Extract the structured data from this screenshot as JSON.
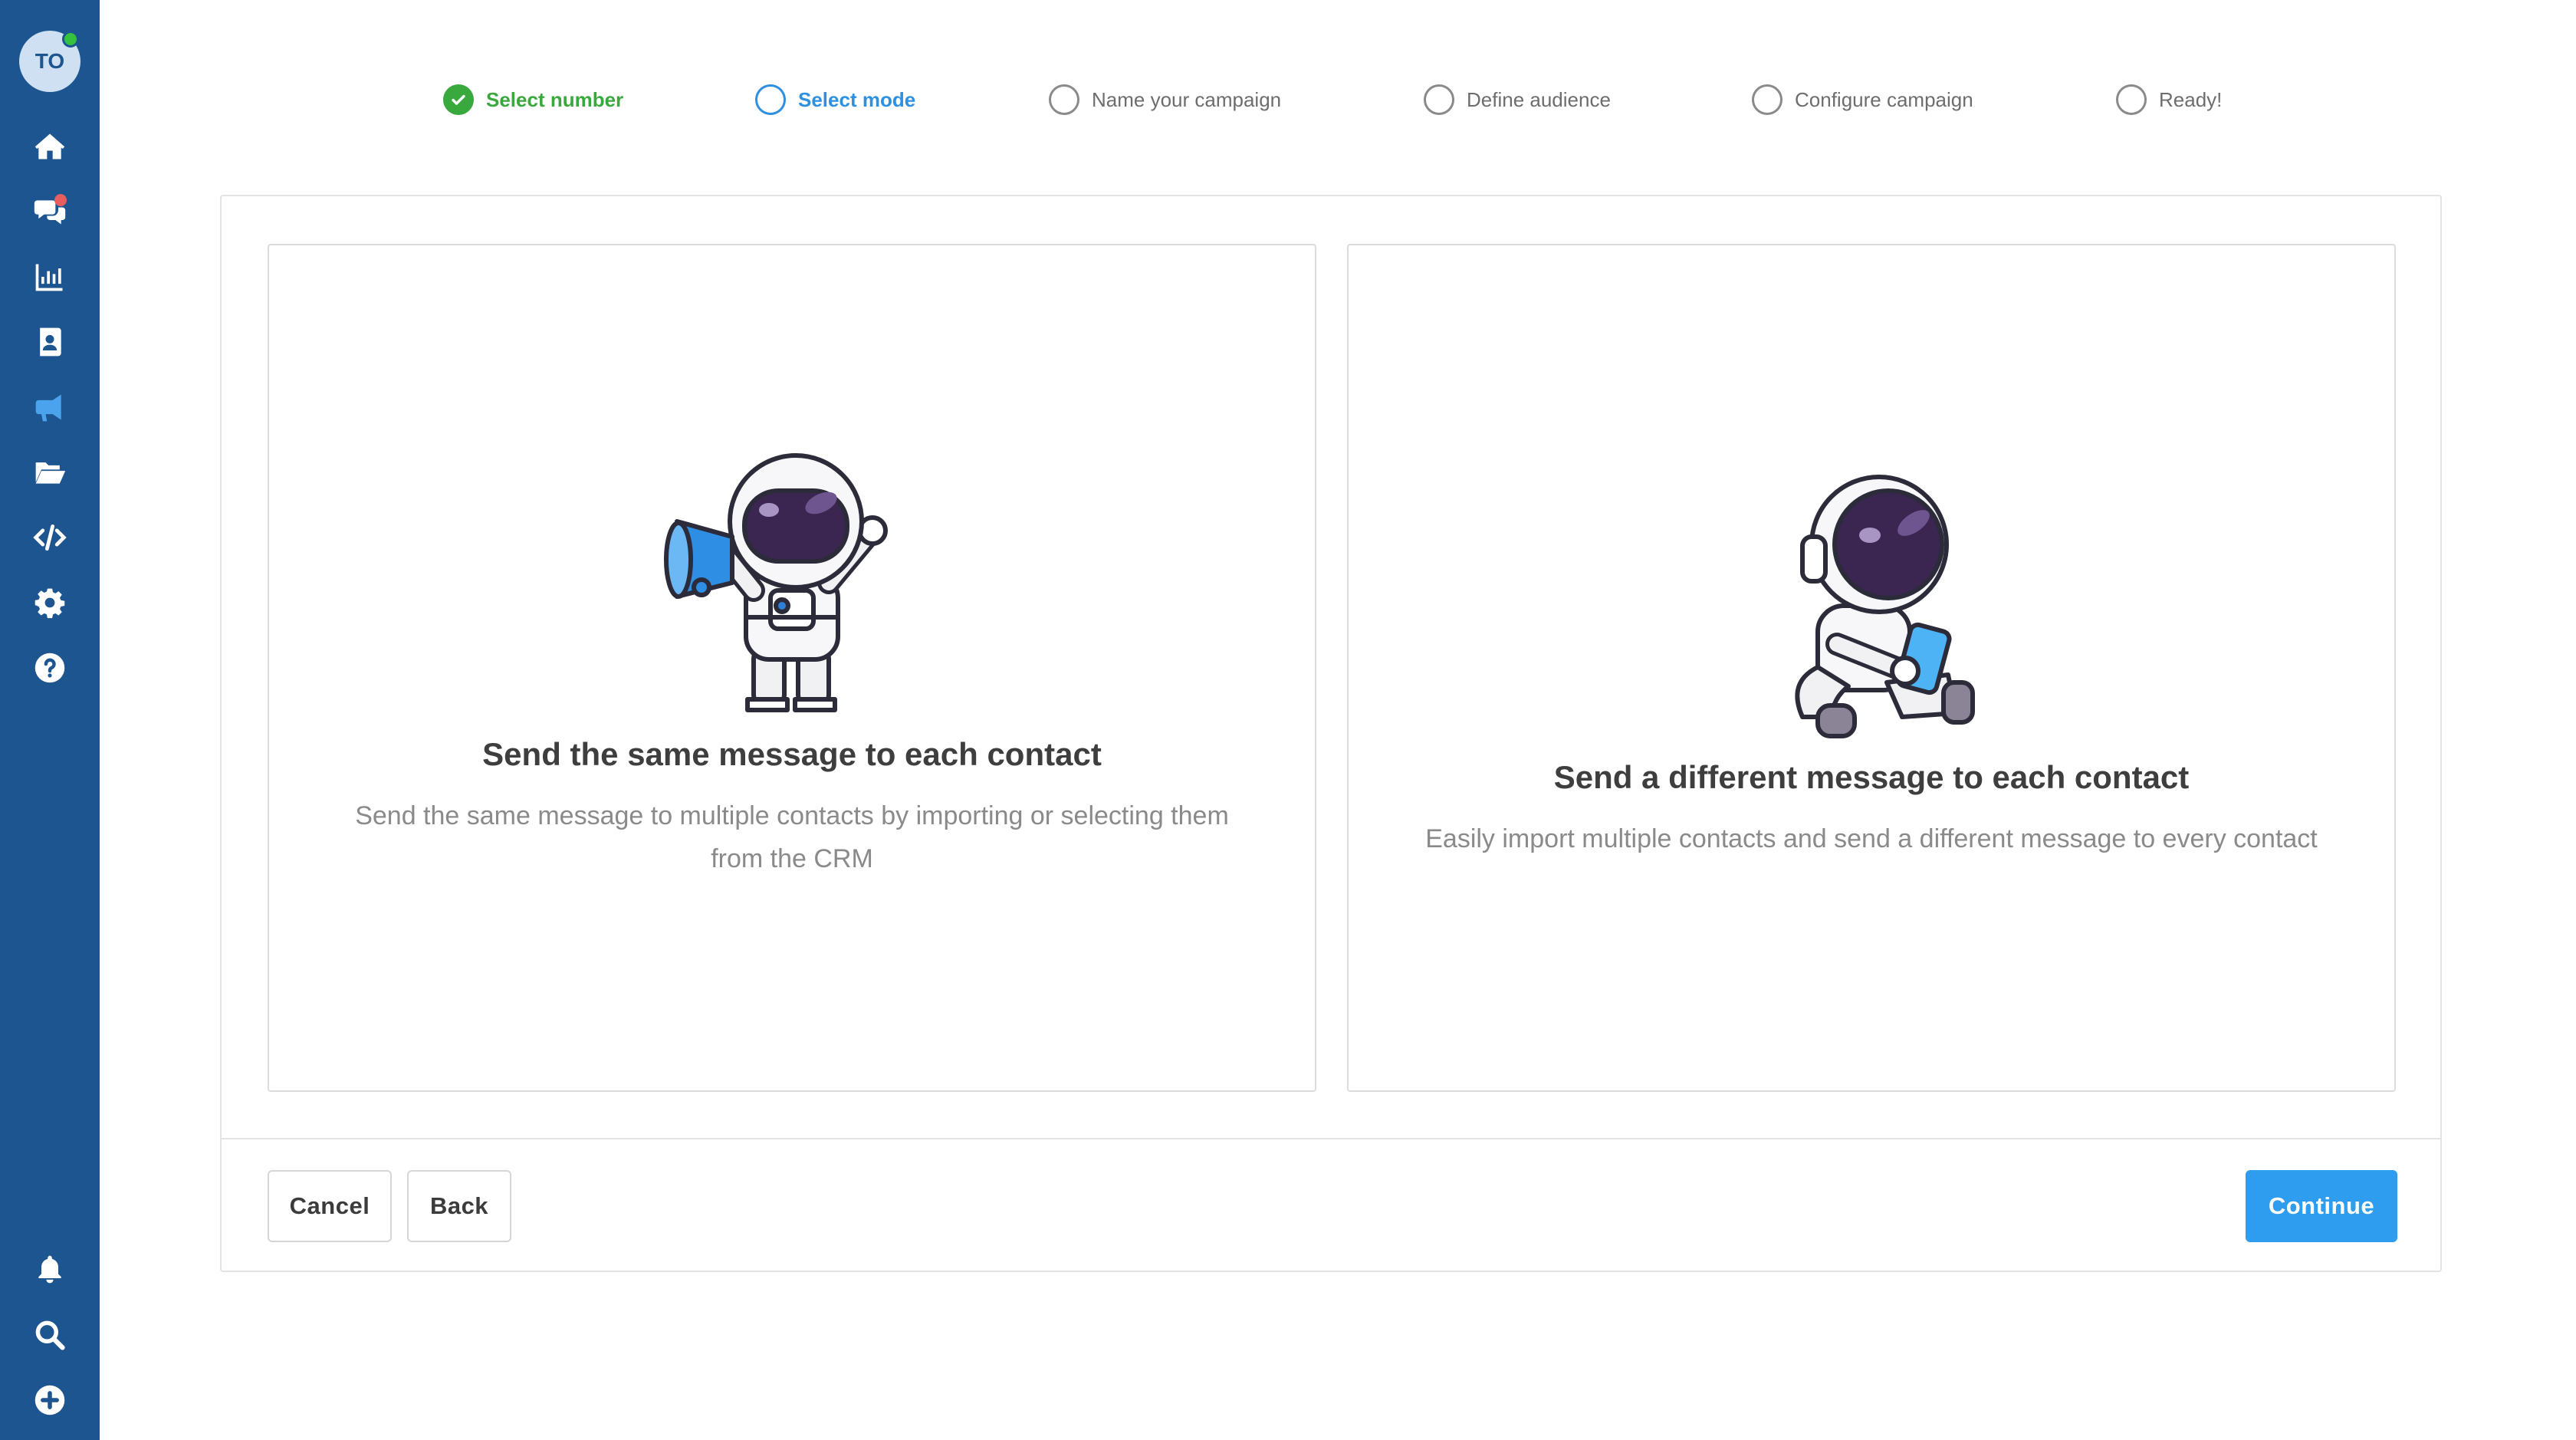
{
  "user": {
    "initials": "TO"
  },
  "colors": {
    "sidebar": "#1c5590",
    "accent": "#2e9cef",
    "success": "#39a83d",
    "notification": "#e85d5d"
  },
  "sidebar": {
    "items": [
      {
        "icon": "home-icon"
      },
      {
        "icon": "chat-icon",
        "has_notification": true
      },
      {
        "icon": "bar-chart-icon"
      },
      {
        "icon": "contacts-icon"
      },
      {
        "icon": "megaphone-icon",
        "active": true
      },
      {
        "icon": "folder-open-icon"
      },
      {
        "icon": "code-icon"
      },
      {
        "icon": "gear-icon"
      },
      {
        "icon": "help-icon"
      }
    ],
    "bottom_items": [
      {
        "icon": "bell-icon"
      },
      {
        "icon": "search-icon"
      },
      {
        "icon": "plus-circle-icon"
      }
    ]
  },
  "stepper": {
    "steps": [
      {
        "label": "Select number",
        "state": "done"
      },
      {
        "label": "Select mode",
        "state": "active"
      },
      {
        "label": "Name your campaign",
        "state": "pending"
      },
      {
        "label": "Define audience",
        "state": "pending"
      },
      {
        "label": "Configure campaign",
        "state": "pending"
      },
      {
        "label": "Ready!",
        "state": "pending"
      }
    ]
  },
  "modes": {
    "same": {
      "title": "Send the same message to each contact",
      "description": "Send the same message to multiple contacts by importing or selecting them from the CRM"
    },
    "different": {
      "title": "Send a different message to each contact",
      "description": "Easily import multiple contacts and send a different message to every contact"
    }
  },
  "footer": {
    "cancel_label": "Cancel",
    "back_label": "Back",
    "continue_label": "Continue"
  }
}
